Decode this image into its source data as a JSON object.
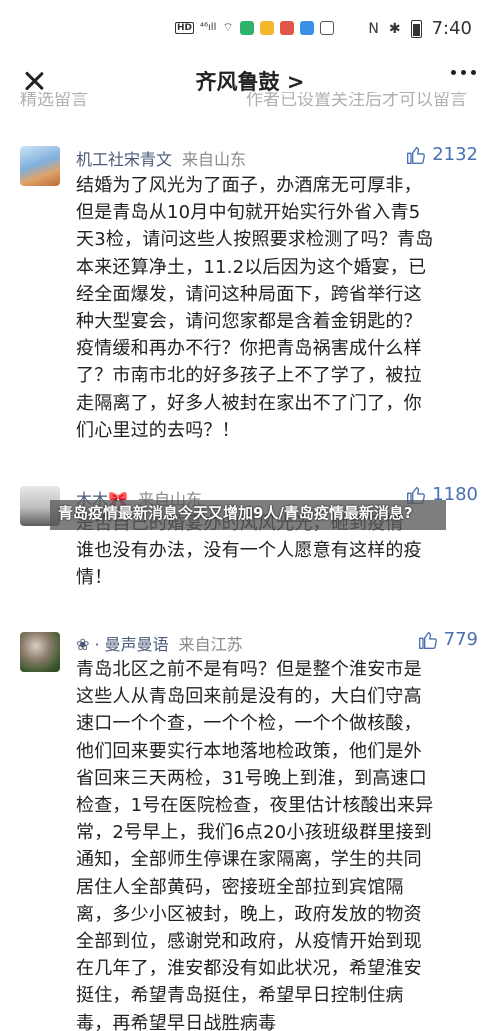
{
  "status_bar": {
    "left_icons": [
      "hd-icon",
      "signal-icon",
      "wifi-icon",
      "app-icon-green",
      "app-icon-yellow",
      "app-icon-red",
      "app-icon-blue",
      "app-icon-outline"
    ],
    "time": "7:40",
    "colors": {
      "green": "#2fb36a",
      "yellow": "#f3b72c",
      "red": "#e25348",
      "blue": "#3a8fe6"
    }
  },
  "nav": {
    "title": "齐风鲁鼓 >"
  },
  "cut_off_header": {
    "left": "精选留言",
    "right": "作者已设置关注后才可以留言"
  },
  "comments": [
    {
      "author": "机工社宋青文",
      "location": "来自山东",
      "likes": "2132",
      "lines": [
        "结婚为了风光为了面子，办酒席无可厚非，",
        "但是青岛从10月中旬就开始实行外省入青5",
        "天3检，请问这些人按照要求检测了吗？青岛",
        "本来还算净土，11.2以后因为这个婚宴，已",
        "经全面爆发，请问这种局面下，跨省举行这",
        "种大型宴会，请问您家都是含着金钥匙的？",
        "疫情缓和再办不行？你把青岛祸害成什么样",
        "了？市南市北的好多孩子上不了学了，被拉",
        "走隔离了，好多人被封在家出不了门了，你",
        "们心里过的去吗？！"
      ]
    },
    {
      "author": "木木🎀",
      "location": "来自山东",
      "likes": "1180",
      "lines": [
        "是否自己的婚宴办的风风光光，砸到疫情",
        "谁也没有办法，没有一个人愿意有这样的疫",
        "情！"
      ]
    },
    {
      "author": "❀ · 曼声曼语",
      "location": "来自江苏",
      "likes": "779",
      "lines": [
        "青岛北区之前不是有吗？但是整个淮安市是",
        "这些人从青岛回来前是没有的，大白们守高",
        "速口一个个查，一个个检，一个个做核酸，",
        "他们回来要实行本地落地检政策，他们是外",
        "省回来三天两检，31号晚上到淮，到高速口",
        "检查，1号在医院检查，夜里估计核酸出来异",
        "常，2号早上，我们6点20小孩班级群里接到",
        "通知，全部师生停课在家隔离，学生的共同",
        "居住人全部黄码，密接班全部拉到宾馆隔",
        "离，多少小区被封，晚上，政府发放的物资",
        "全部到位，感谢党和政府，从疫情开始到现",
        "在几年了，淮安都没有如此状况，希望淮安",
        "挺住，希望青岛挺住，希望早日控制住病",
        "毒，再希望早日战胜病毒"
      ]
    }
  ],
  "overlay_caption": "青岛疫情最新消息今天又增加9人/青岛疫情最新消息?"
}
